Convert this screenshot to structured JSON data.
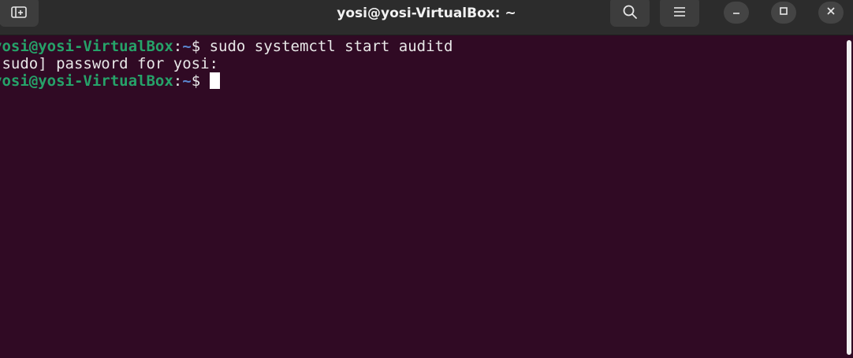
{
  "window": {
    "title": "yosi@yosi-VirtualBox: ~"
  },
  "header_icons": {
    "new_tab": "new-tab-icon",
    "search": "search-icon",
    "menu": "hamburger-menu-icon",
    "minimize": "minimize-icon",
    "maximize": "maximize-icon",
    "close": "close-icon"
  },
  "colors": {
    "terminal_bg": "#300a24",
    "prompt_user": "#26a269",
    "prompt_path": "#5a86cf",
    "text": "#e8e8e8",
    "titlebar": "#2c2c2c"
  },
  "terminal": {
    "lines": [
      {
        "prompt_user": "yosi@yosi-VirtualBox",
        "prompt_sep": ":",
        "prompt_path": "~",
        "prompt_symbol": "$ ",
        "command": "sudo systemctl start auditd"
      },
      {
        "output": "[sudo] password for yosi:"
      },
      {
        "prompt_user": "yosi@yosi-VirtualBox",
        "prompt_sep": ":",
        "prompt_path": "~",
        "prompt_symbol": "$ ",
        "command": ""
      }
    ]
  }
}
